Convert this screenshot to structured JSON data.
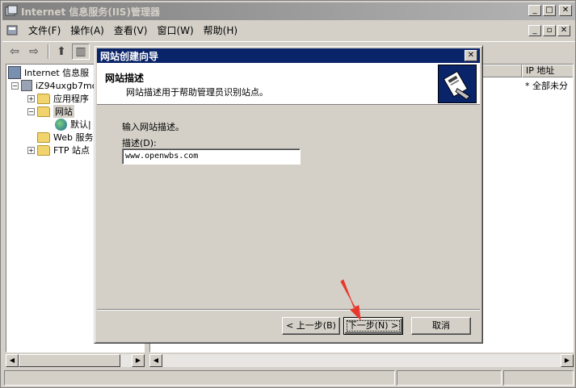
{
  "window": {
    "title": "Internet 信息服务(IIS)管理器",
    "min_glyph": "_",
    "max_glyph": "□",
    "close_glyph": "✕",
    "restore_glyph": "▫"
  },
  "menu": {
    "items": [
      "文件(F)",
      "操作(A)",
      "查看(V)",
      "窗口(W)",
      "帮助(H)"
    ]
  },
  "toolbar": {
    "back_glyph": "⇦",
    "forward_glyph": "⇨",
    "up_glyph": "⬆",
    "tree_glyph": "▥"
  },
  "tree": {
    "root": "Internet 信息服",
    "server": "iZ94uxgb7mo",
    "app_pools": "应用程序",
    "websites": "网站",
    "default_site": "默认|",
    "web_ext": "Web 服务",
    "ftp_sites": "FTP 站点",
    "plus": "+",
    "minus": "−"
  },
  "list": {
    "ip_header": "IP 地址",
    "ip_value": "* 全部未分"
  },
  "scroll": {
    "left": "◀",
    "right": "▶"
  },
  "wizard": {
    "title": "网站创建向导",
    "close_glyph": "✕",
    "header_title": "网站描述",
    "header_subtitle": "网站描述用于帮助管理员识别站点。",
    "prompt": "输入网站描述。",
    "field_label": "描述(D):",
    "field_value": "www.openwbs.com",
    "back_button": "< 上一步(B)",
    "next_button": "下一步(N) >",
    "cancel_button": "取消"
  },
  "colors": {
    "wizard_title_bg": "#0a246a",
    "arrow": "#e8382e"
  }
}
